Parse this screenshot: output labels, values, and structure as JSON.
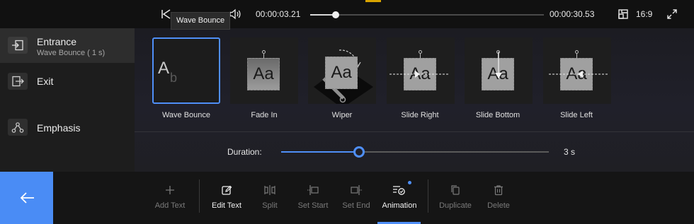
{
  "player": {
    "current_time": "00:00:03.21",
    "total_time": "00:00:30.53",
    "progress": 0.11,
    "aspect_ratio": "16:9"
  },
  "tooltip": {
    "text": "Wave Bounce"
  },
  "categories": [
    {
      "title": "Entrance",
      "subtitle": "Wave Bounce ( 1 s)",
      "icon": "entrance-icon",
      "active": true
    },
    {
      "title": "Exit",
      "subtitle": "",
      "icon": "exit-icon",
      "active": false
    },
    {
      "title": "Emphasis",
      "subtitle": "",
      "icon": "emphasis-icon",
      "active": false
    }
  ],
  "animations": [
    {
      "label": "Wave Bounce",
      "preview_text": "A",
      "preview_sub": "b",
      "selected": true
    },
    {
      "label": "Fade In",
      "preview_text": "Aa",
      "selected": false
    },
    {
      "label": "Wiper",
      "preview_text": "Aa",
      "selected": false
    },
    {
      "label": "Slide Right",
      "preview_text": "Aa",
      "selected": false
    },
    {
      "label": "Slide Bottom",
      "preview_text": "Aa",
      "selected": false
    },
    {
      "label": "Slide Left",
      "preview_text": "Aa",
      "selected": false
    }
  ],
  "duration": {
    "label": "Duration:",
    "value_text": "3 s",
    "fraction": 0.29
  },
  "toolbar": {
    "items": [
      {
        "label": "Add Text",
        "icon": "plus-icon",
        "enabled": false
      },
      {
        "label": "Edit Text",
        "icon": "edit-icon",
        "enabled": true
      },
      {
        "label": "Split",
        "icon": "split-icon",
        "enabled": false
      },
      {
        "label": "Set Start",
        "icon": "set-start-icon",
        "enabled": false
      },
      {
        "label": "Set End",
        "icon": "set-end-icon",
        "enabled": false
      },
      {
        "label": "Animation",
        "icon": "animation-icon",
        "enabled": true,
        "active": true
      },
      {
        "label": "Duplicate",
        "icon": "duplicate-icon",
        "enabled": false
      },
      {
        "label": "Delete",
        "icon": "delete-icon",
        "enabled": false
      }
    ]
  },
  "colors": {
    "accent": "#4f8ff7",
    "back_button": "#4a8cf5",
    "background": "#1b1b1b"
  }
}
